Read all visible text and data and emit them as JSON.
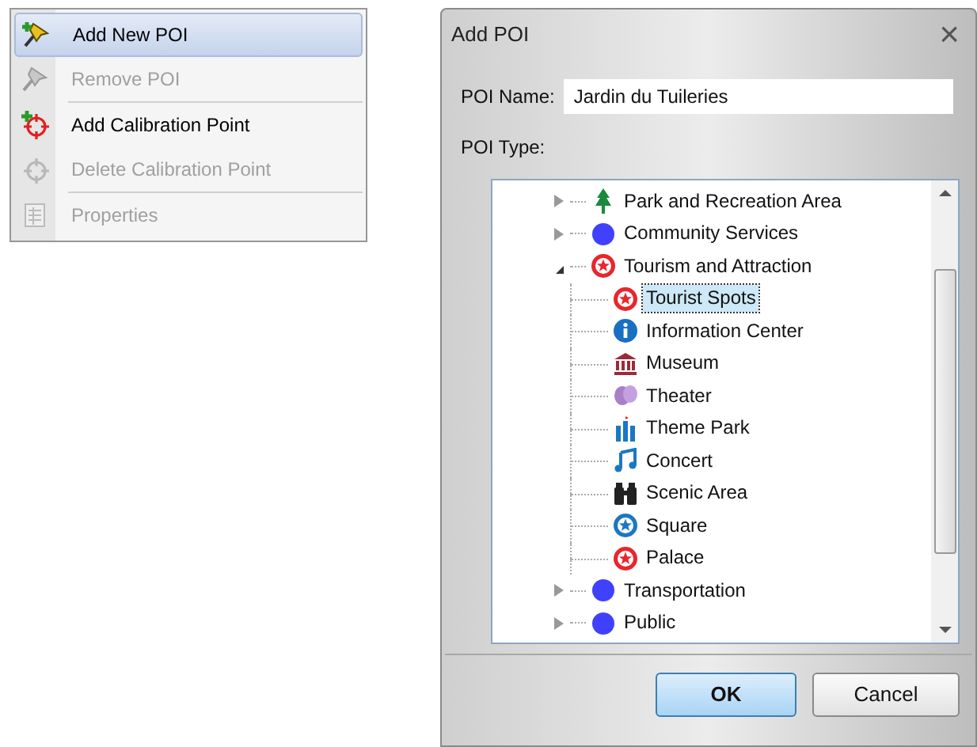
{
  "context_menu": {
    "items": [
      {
        "label": "Add New POI",
        "kind": "pin-add",
        "disabled": false,
        "selected": true,
        "divider_after": false
      },
      {
        "label": "Remove POI",
        "kind": "pin",
        "disabled": true,
        "selected": false,
        "divider_after": true
      },
      {
        "label": "Add Calibration Point",
        "kind": "target-add",
        "disabled": false,
        "selected": false,
        "divider_after": false
      },
      {
        "label": "Delete Calibration Point",
        "kind": "target",
        "disabled": true,
        "selected": false,
        "divider_after": true
      },
      {
        "label": "Properties",
        "kind": "sheet",
        "disabled": true,
        "selected": false,
        "divider_after": false
      }
    ]
  },
  "dialog": {
    "title": "Add POI",
    "close": "×",
    "name_label": "POI Name:",
    "name_value": "Jardin du Tuileries",
    "type_label": "POI Type:",
    "tree": [
      {
        "label": "Park and Recreation Area",
        "kind": "tree",
        "expanded": false,
        "selected": false
      },
      {
        "label": "Community Services",
        "kind": "dot",
        "expanded": false,
        "selected": false
      },
      {
        "label": "Tourism and Attraction",
        "kind": "star-red",
        "expanded": true,
        "selected": false,
        "children": [
          {
            "label": "Tourist Spots",
            "kind": "star-red",
            "selected": true
          },
          {
            "label": "Information Center",
            "kind": "info",
            "selected": false
          },
          {
            "label": "Museum",
            "kind": "museum",
            "selected": false
          },
          {
            "label": "Theater",
            "kind": "masks",
            "selected": false
          },
          {
            "label": "Theme Park",
            "kind": "castle",
            "selected": false
          },
          {
            "label": "Concert",
            "kind": "music",
            "selected": false
          },
          {
            "label": "Scenic Area",
            "kind": "binoculars",
            "selected": false
          },
          {
            "label": "Square",
            "kind": "star-blue",
            "selected": false
          },
          {
            "label": "Palace",
            "kind": "star-red",
            "selected": false
          }
        ]
      },
      {
        "label": "Transportation",
        "kind": "dot",
        "expanded": false,
        "selected": false
      },
      {
        "label": "Public",
        "kind": "dot",
        "expanded": false,
        "selected": false
      }
    ],
    "buttons": [
      {
        "label": "OK",
        "default": true
      },
      {
        "label": "Cancel",
        "default": false
      }
    ]
  }
}
